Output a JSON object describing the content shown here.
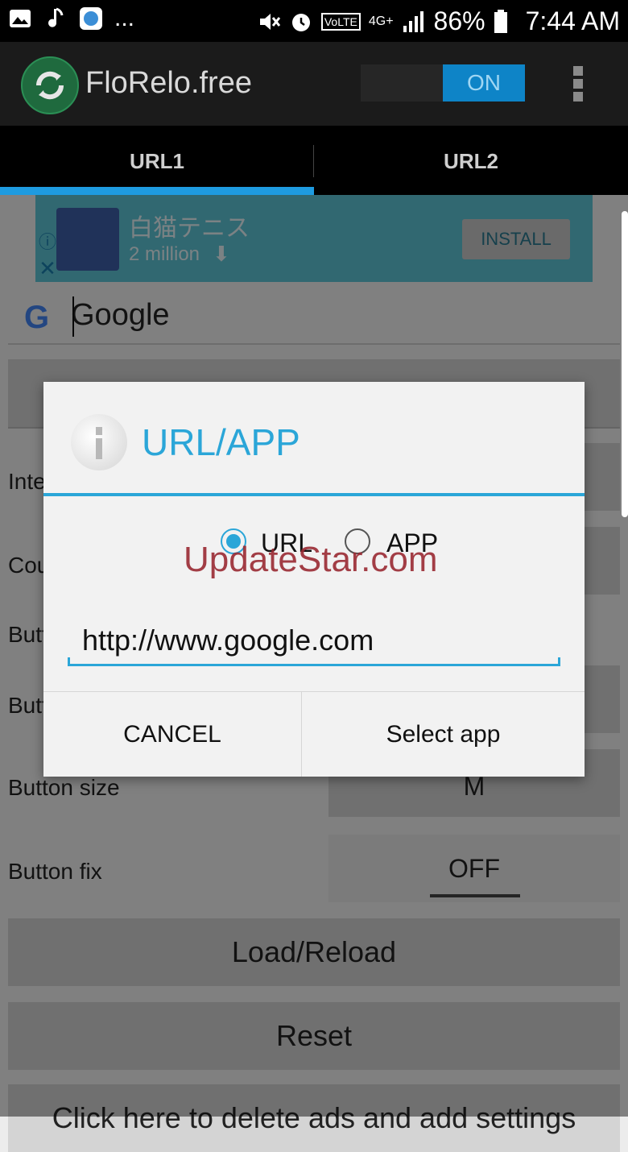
{
  "status_bar": {
    "more": "...",
    "battery": "86%",
    "time": "7:44 AM",
    "network": "4G+",
    "volte": "VoLTE"
  },
  "app_bar": {
    "title": "FloRelo.free",
    "toggle_label": "ON"
  },
  "tabs": [
    {
      "label": "URL1"
    },
    {
      "label": "URL2"
    }
  ],
  "ad": {
    "title": "白猫テニス",
    "downloads": "2 million",
    "install_label": "INSTALL"
  },
  "url_field": {
    "value": "Google"
  },
  "settings": {
    "row_labels": [
      "Inte",
      "Cou",
      "Butt",
      "Butt"
    ],
    "button_size_label": "Button size",
    "button_size_value": "M",
    "button_fix_label": "Button fix",
    "button_fix_value": "OFF"
  },
  "actions": {
    "load_reload": "Load/Reload",
    "reset": "Reset",
    "delete_ads": "Click here to delete ads and add settings"
  },
  "dialog": {
    "title": "URL/APP",
    "option_url": "URL",
    "option_app": "APP",
    "selected": "URL",
    "url_value": "http://www.google.com",
    "cancel_label": "CANCEL",
    "select_app_label": "Select app"
  },
  "watermark": "UpdateStar.com",
  "colors": {
    "accent": "#2ba6d8",
    "toggle_on": "#0e84c7",
    "ad_background": "#5ec4d6"
  }
}
